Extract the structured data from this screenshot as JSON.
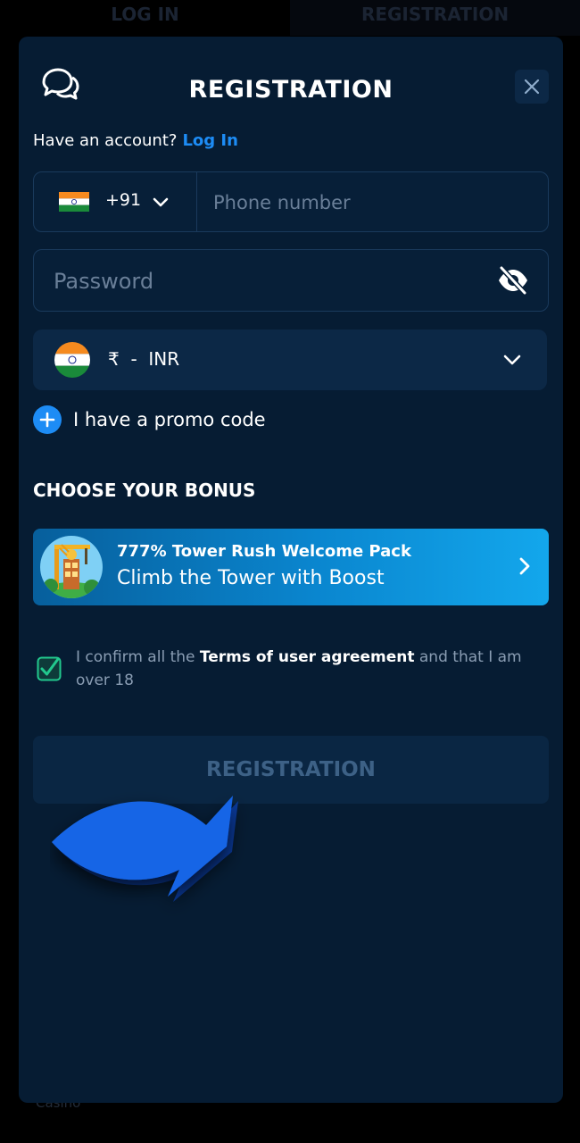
{
  "background": {
    "tab_login": "LOG IN",
    "tab_registration": "REGISTRATION",
    "footer_text": "Casino"
  },
  "modal": {
    "title": "REGISTRATION",
    "chat_icon": "chat-bubbles-icon",
    "close_icon": "close-icon"
  },
  "account": {
    "prompt": "Have an account?",
    "login_link": "Log In"
  },
  "phone": {
    "country_code": "+91",
    "flag_icon": "india-flag-icon",
    "placeholder": "Phone number",
    "value": ""
  },
  "password": {
    "placeholder": "Password",
    "value": "",
    "visibility_icon": "eye-off-icon"
  },
  "currency": {
    "symbol": "₹",
    "separator": "-",
    "code": "INR",
    "flag_icon": "india-flag-icon"
  },
  "promo": {
    "label": "I have a promo code",
    "icon": "plus-circle-icon"
  },
  "bonus_section": {
    "heading": "CHOOSE YOUR BONUS",
    "card": {
      "title": "777% Tower Rush Welcome Pack",
      "subtitle": "Climb the Tower with Boost",
      "icon": "chevron-right-icon"
    }
  },
  "terms": {
    "checked": true,
    "text_before": "I confirm all the",
    "link": "Terms of user agreement",
    "text_after": "and that I am over 18"
  },
  "submit": {
    "label": "REGISTRATION"
  },
  "colors": {
    "modal_bg": "#061c33",
    "accent": "#1d8cf5",
    "checkbox": "#22c98e",
    "arrow": "#1565e6"
  }
}
